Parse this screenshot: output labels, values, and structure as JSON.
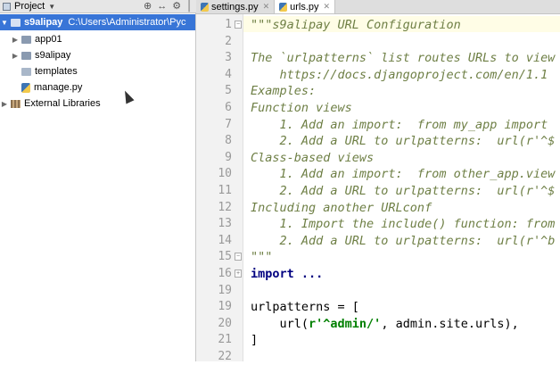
{
  "project_panel": {
    "title": "Project",
    "tools": [
      "⊕",
      "↔",
      "⚙",
      "│"
    ],
    "tree": [
      {
        "label": "s9alipay",
        "path": "C:\\Users\\Administrator\\Pyc",
        "type": "root",
        "expanded": true,
        "selected": true
      },
      {
        "label": "app01",
        "type": "folder",
        "expanded": false
      },
      {
        "label": "s9alipay",
        "type": "folder",
        "expanded": false
      },
      {
        "label": "templates",
        "type": "folder-light"
      },
      {
        "label": "manage.py",
        "type": "python-file"
      },
      {
        "label": "External Libraries",
        "type": "library",
        "expanded": false
      }
    ]
  },
  "tabs": [
    {
      "label": "settings.py",
      "active": false
    },
    {
      "label": "urls.py",
      "active": true
    }
  ],
  "editor": {
    "lines": [
      {
        "n": "1",
        "segments": [
          {
            "t": "\"\"\"s9alipay URL Configuration",
            "c": "doc"
          }
        ]
      },
      {
        "n": "2",
        "segments": []
      },
      {
        "n": "3",
        "segments": [
          {
            "t": "The `urlpatterns` list routes URLs to view",
            "c": "doc"
          }
        ]
      },
      {
        "n": "4",
        "segments": [
          {
            "t": "    https://docs.djangoproject.com/en/1.1",
            "c": "doc"
          }
        ]
      },
      {
        "n": "5",
        "segments": [
          {
            "t": "Examples:",
            "c": "doc"
          }
        ]
      },
      {
        "n": "6",
        "segments": [
          {
            "t": "Function views",
            "c": "doc"
          }
        ]
      },
      {
        "n": "7",
        "segments": [
          {
            "t": "    1. Add an import:  from my_app import",
            "c": "doc"
          }
        ]
      },
      {
        "n": "8",
        "segments": [
          {
            "t": "    2. Add a URL to urlpatterns:  url(r'^$",
            "c": "doc"
          }
        ]
      },
      {
        "n": "9",
        "segments": [
          {
            "t": "Class-based views",
            "c": "doc"
          }
        ]
      },
      {
        "n": "10",
        "segments": [
          {
            "t": "    1. Add an import:  from other_app.view",
            "c": "doc"
          }
        ]
      },
      {
        "n": "11",
        "segments": [
          {
            "t": "    2. Add a URL to urlpatterns:  url(r'^$",
            "c": "doc"
          }
        ]
      },
      {
        "n": "12",
        "segments": [
          {
            "t": "Including another URLconf",
            "c": "doc"
          }
        ]
      },
      {
        "n": "13",
        "segments": [
          {
            "t": "    1. Import the include() function: from",
            "c": "doc"
          }
        ]
      },
      {
        "n": "14",
        "segments": [
          {
            "t": "    2. Add a URL to urlpatterns:  url(r'^b",
            "c": "doc"
          }
        ]
      },
      {
        "n": "15",
        "segments": [
          {
            "t": "\"\"\"",
            "c": "doc"
          }
        ]
      },
      {
        "n": "16",
        "segments": [
          {
            "t": "import ...",
            "c": "kw"
          }
        ]
      },
      {
        "n": "19",
        "segments": []
      },
      {
        "n": "19",
        "segments": [
          {
            "t": "urlpatterns = [",
            "c": ""
          }
        ]
      },
      {
        "n": "20",
        "segments": [
          {
            "t": "    url(",
            "c": ""
          },
          {
            "t": "r'^admin/'",
            "c": "str"
          },
          {
            "t": ", admin.site.urls),",
            "c": ""
          }
        ]
      },
      {
        "n": "21",
        "segments": [
          {
            "t": "]",
            "c": ""
          }
        ]
      },
      {
        "n": "22",
        "segments": []
      }
    ]
  },
  "colors": {
    "selection": "#3875d7",
    "docstring": "#6e7f45",
    "keyword": "#000080",
    "string": "#008000"
  }
}
